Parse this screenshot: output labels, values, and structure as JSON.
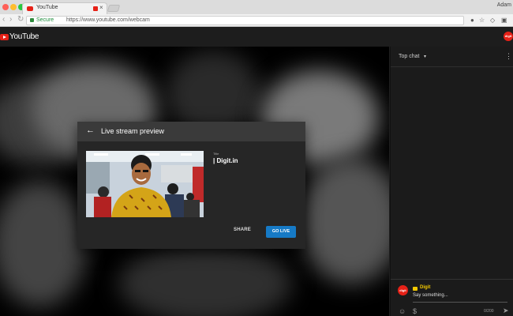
{
  "browser": {
    "tab_title": "YouTube",
    "tab_close": "×",
    "window_user": "Adam",
    "secure_label": "Secure",
    "url": "https://www.youtube.com/webcam"
  },
  "youtube": {
    "logo_text": "YouTube",
    "avatar_text": "digit"
  },
  "chat": {
    "header_label": "Top chat",
    "caret": "▾",
    "menu": "⋮",
    "user_name": "Digit",
    "avatar_text": "digit",
    "input_placeholder": "Say something...",
    "char_count": "0/200",
    "send": "➤",
    "emoji_icon": "☺",
    "currency_icon": "$"
  },
  "modal": {
    "back": "←",
    "title": "Live stream preview",
    "title_label": "Title",
    "title_value": "| Digit.in",
    "share_button": "SHARE",
    "golive_button": "GO LIVE"
  },
  "colors": {
    "accent": "#167ac6",
    "brand": "#e62117",
    "badge": "#f2c800"
  }
}
